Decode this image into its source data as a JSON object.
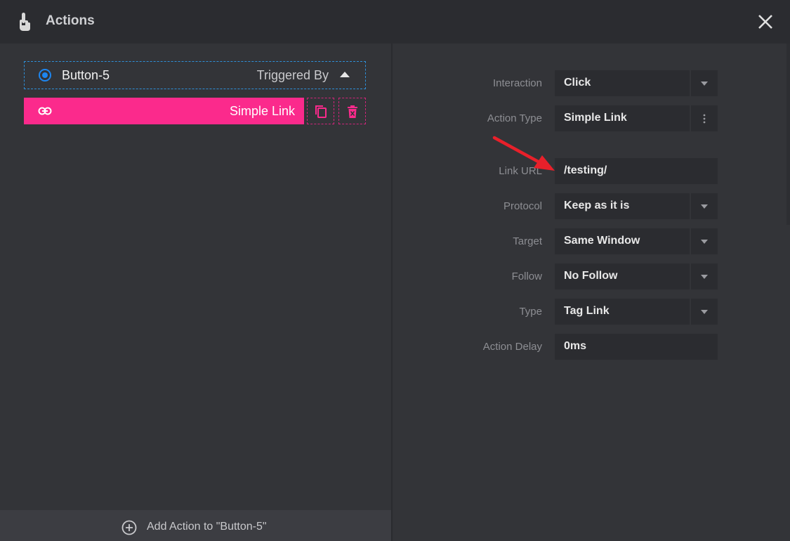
{
  "header": {
    "title": "Actions",
    "icon": "pointer-hand-icon",
    "close_icon": "close-icon"
  },
  "trigger": {
    "name": "Button-5",
    "triggered_by": "Triggered By",
    "selected": true
  },
  "action_item": {
    "label": "Simple Link",
    "icon": "link-icon",
    "accent": "#fb2a8c"
  },
  "footer": {
    "add_label": "Add Action to \"Button-5\""
  },
  "fields": {
    "interaction": {
      "label": "Interaction",
      "value": "Click"
    },
    "action_type": {
      "label": "Action Type",
      "value": "Simple Link"
    },
    "link_url": {
      "label": "Link URL",
      "value": "/testing/"
    },
    "protocol": {
      "label": "Protocol",
      "value": "Keep as it is"
    },
    "target": {
      "label": "Target",
      "value": "Same Window"
    },
    "follow": {
      "label": "Follow",
      "value": "No Follow"
    },
    "type": {
      "label": "Type",
      "value": "Tag Link"
    },
    "action_delay": {
      "label": "Action Delay",
      "value": "0ms"
    }
  },
  "colors": {
    "background": "#333438",
    "header": "#2b2c30",
    "accent_blue": "#1d86f0",
    "annotation_arrow": "#e8202a"
  }
}
